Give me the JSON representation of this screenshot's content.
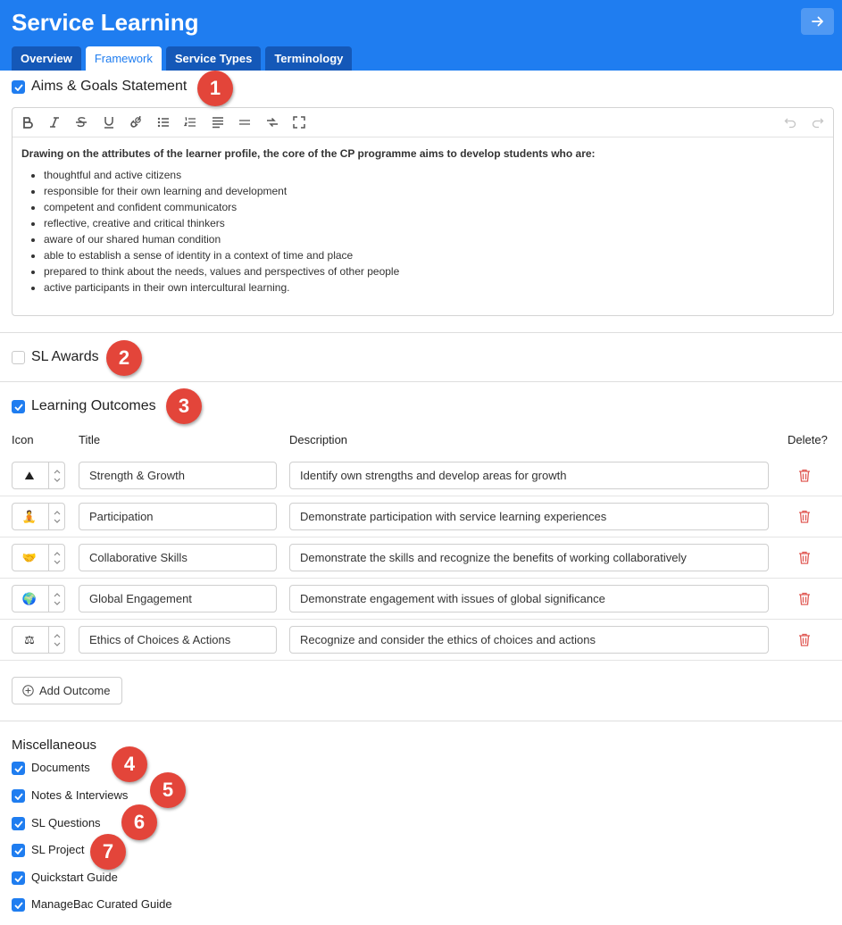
{
  "header": {
    "title": "Service Learning",
    "exit_icon": "arrow-right-icon",
    "tabs": [
      {
        "label": "Overview",
        "active": false
      },
      {
        "label": "Framework",
        "active": true
      },
      {
        "label": "Service Types",
        "active": false
      },
      {
        "label": "Terminology",
        "active": false
      }
    ]
  },
  "aims": {
    "label": "Aims & Goals Statement",
    "checked": true,
    "badge": "1",
    "intro": "Drawing on the attributes of the learner profile, the core of the CP programme aims to develop students who are:",
    "items": [
      "thoughtful and active citizens",
      "responsible for their own learning and development",
      "competent and confident communicators",
      "reflective, creative and critical thinkers",
      "aware of our shared human condition",
      "able to establish a sense of identity in a context of time and place",
      "prepared to think about the needs, values and perspectives of other people",
      "active participants in their own intercultural learning."
    ]
  },
  "awards": {
    "label": "SL Awards",
    "checked": false,
    "badge": "2"
  },
  "outcomes": {
    "label": "Learning Outcomes",
    "checked": true,
    "badge": "3",
    "headers": {
      "icon": "Icon",
      "title": "Title",
      "description": "Description",
      "delete": "Delete?"
    },
    "rows": [
      {
        "emoji": "⛰",
        "title": "Strength & Growth",
        "description": "Identify own strengths and develop areas for growth"
      },
      {
        "emoji": "🧘",
        "title": "Participation",
        "description": "Demonstrate participation with service learning experiences"
      },
      {
        "emoji": "🤝",
        "title": "Collaborative Skills",
        "description": "Demonstrate the skills and recognize the benefits of working collaboratively"
      },
      {
        "emoji": "🌍",
        "title": "Global Engagement",
        "description": "Demonstrate engagement with issues of global significance"
      },
      {
        "emoji": "⚖",
        "title": "Ethics of Choices & Actions",
        "description": "Recognize and consider the ethics of choices and actions"
      }
    ],
    "add_label": "Add Outcome"
  },
  "misc": {
    "title": "Miscellaneous",
    "items": [
      {
        "label": "Documents",
        "checked": true,
        "badge": "4"
      },
      {
        "label": "Notes & Interviews",
        "checked": true,
        "badge": "5"
      },
      {
        "label": "SL Questions",
        "checked": true,
        "badge": "6"
      },
      {
        "label": "SL Project",
        "checked": true,
        "badge": "7"
      },
      {
        "label": "Quickstart Guide",
        "checked": true
      },
      {
        "label": "ManageBac Curated Guide",
        "checked": true
      }
    ]
  },
  "colors": {
    "primary": "#1f7df0",
    "tab_inactive": "#1458b8",
    "badge": "#e3453a",
    "trash": "#e05a55"
  }
}
